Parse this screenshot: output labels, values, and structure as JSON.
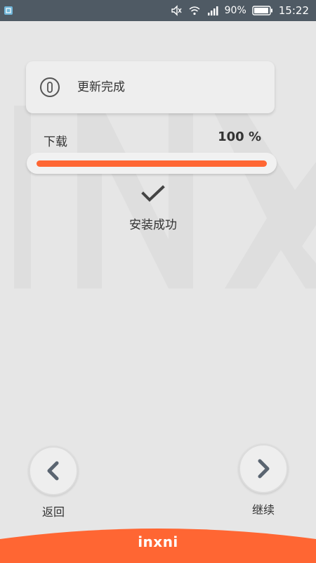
{
  "status_bar": {
    "battery": "90%",
    "time": "15:22",
    "icons": [
      "screenshot-icon",
      "mute-icon",
      "wifi-icon",
      "signal-icon",
      "battery-icon"
    ]
  },
  "info_card": {
    "icon": "info-icon",
    "text": "更新完成"
  },
  "download": {
    "label": "下载",
    "percent_text": "100 %",
    "progress": 1.0
  },
  "success": {
    "icon": "check-icon",
    "text": "安装成功"
  },
  "nav": {
    "back_label": "返回",
    "next_label": "继续"
  },
  "footer": {
    "logo": "inxni"
  },
  "colors": {
    "accent": "#ff6633",
    "status_bar": "#4f5a64",
    "background": "#e6e6e6"
  }
}
